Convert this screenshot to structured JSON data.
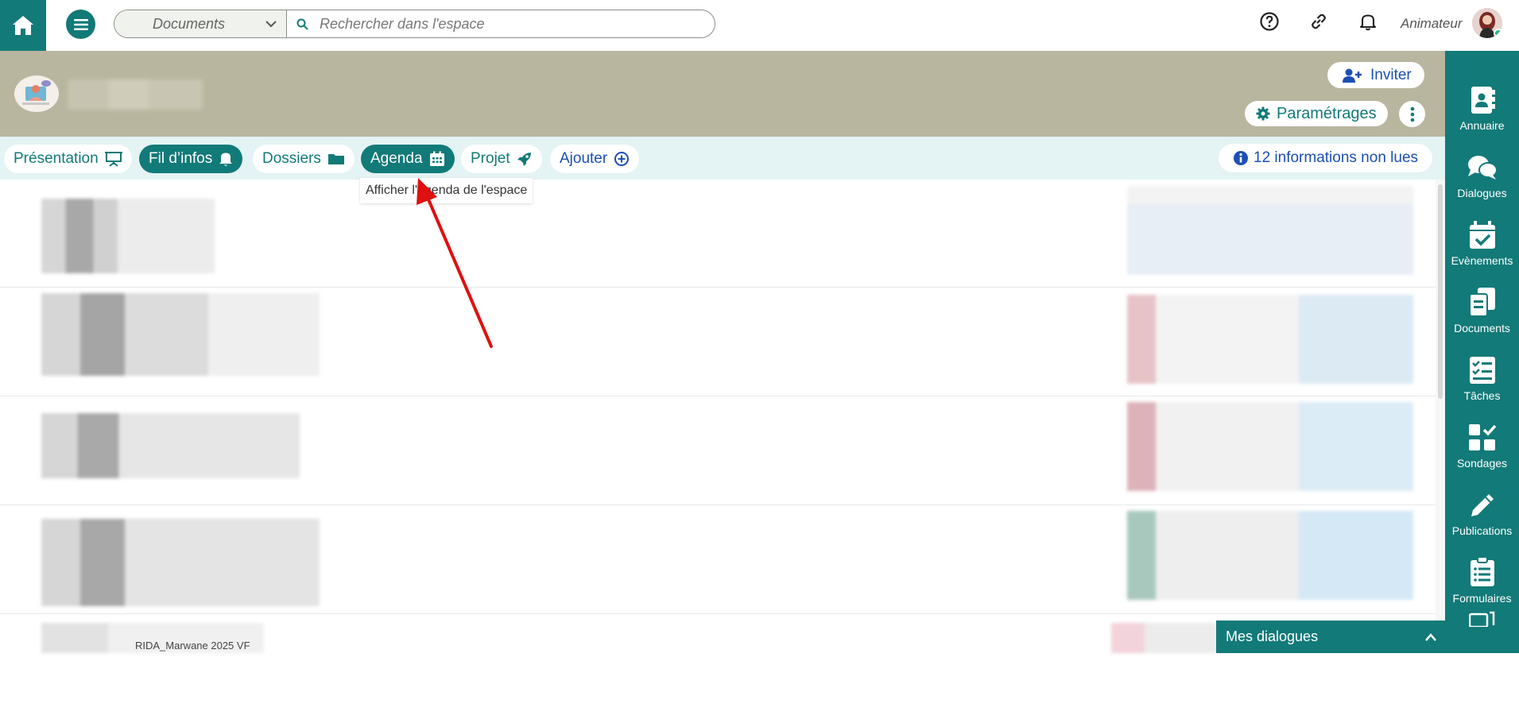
{
  "topbar": {
    "search_scope": "Documents",
    "search_placeholder": "Rechercher dans l'espace",
    "role": "Animateur",
    "icons": [
      "home-icon",
      "menu-icon",
      "help-icon",
      "link-icon",
      "bell-icon"
    ]
  },
  "banner": {
    "invite_label": "Inviter",
    "settings_label": "Paramétrages"
  },
  "tabs": [
    {
      "label": "Présentation",
      "icon": "presentation-icon"
    },
    {
      "label": "Fil d’infos",
      "icon": "bell-icon"
    },
    {
      "label": "Dossiers",
      "icon": "folder-icon"
    },
    {
      "label": "Agenda",
      "icon": "calendar-icon"
    },
    {
      "label": "Projet",
      "icon": "rocket-icon"
    },
    {
      "label": "Ajouter",
      "icon": "plus-circle-icon"
    }
  ],
  "unread_label": "12 informations non lues",
  "tooltip": "Afficher l'agenda de l'espace",
  "sidebar": {
    "items": [
      {
        "label": "Annuaire",
        "icon": "directory-icon"
      },
      {
        "label": "Dialogues",
        "icon": "chat-icon"
      },
      {
        "label": "Evènements",
        "icon": "calendar-check-icon"
      },
      {
        "label": "Documents",
        "icon": "documents-icon"
      },
      {
        "label": "Tâches",
        "icon": "tasks-icon"
      },
      {
        "label": "Sondages",
        "icon": "poll-icon"
      },
      {
        "label": "Publications",
        "icon": "pencil-icon"
      },
      {
        "label": "Formulaires",
        "icon": "form-icon"
      }
    ]
  },
  "chat_panel": {
    "label": "Mes dialogues"
  },
  "bottom_file": "RIDA_Marwane 2025 VF",
  "colors": {
    "brand": "#127a78",
    "accent_blue": "#1b4fb3",
    "banner": "#b8b69e",
    "tabsbar": "#e4f3f4",
    "arrow": "#e01010"
  }
}
